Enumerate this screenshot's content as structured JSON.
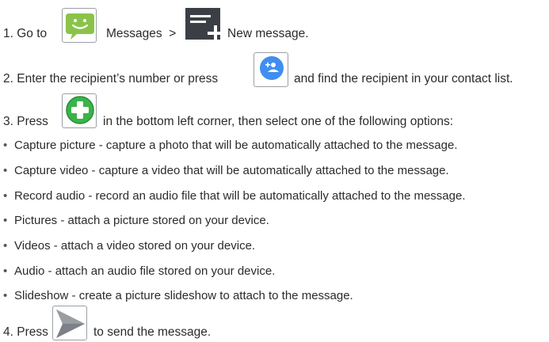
{
  "steps": {
    "s1": {
      "num": "1.",
      "go": "Go to",
      "messages": "Messages",
      "sep": ">",
      "new_message": "New message."
    },
    "s2": {
      "num": "2.",
      "pre": "Enter the recipient’s number or press",
      "post": "and find the recipient in your contact list."
    },
    "s3": {
      "num": "3.",
      "pre": "Press",
      "post": "in the bottom left corner, then select one of the following options:"
    },
    "s4": {
      "num": "4.",
      "pre": "Press",
      "post": "to send the message."
    }
  },
  "options": [
    "Capture picture - capture a photo that will be automatically attached to the message.",
    "Capture video - capture a video that will be automatically attached to the message.",
    "Record audio - record an audio file that will be automatically attached to the message.",
    "Pictures - attach a picture stored on your device.",
    "Videos - attach a video stored on your device.",
    "Audio - attach an audio file stored on your device.",
    "Slideshow - create a picture slideshow to attach to the message."
  ],
  "icons": {
    "messages": "messages-app-icon",
    "new_message": "new-message-icon",
    "add_contact": "add-contact-icon",
    "attach": "attach-plus-icon",
    "send": "send-icon"
  },
  "colors": {
    "messages_green": "#8bc34a",
    "contact_blue": "#3f8ef0",
    "attach_green": "#38b449",
    "send_gray": "#7d8187",
    "text": "#2b2b2b"
  }
}
